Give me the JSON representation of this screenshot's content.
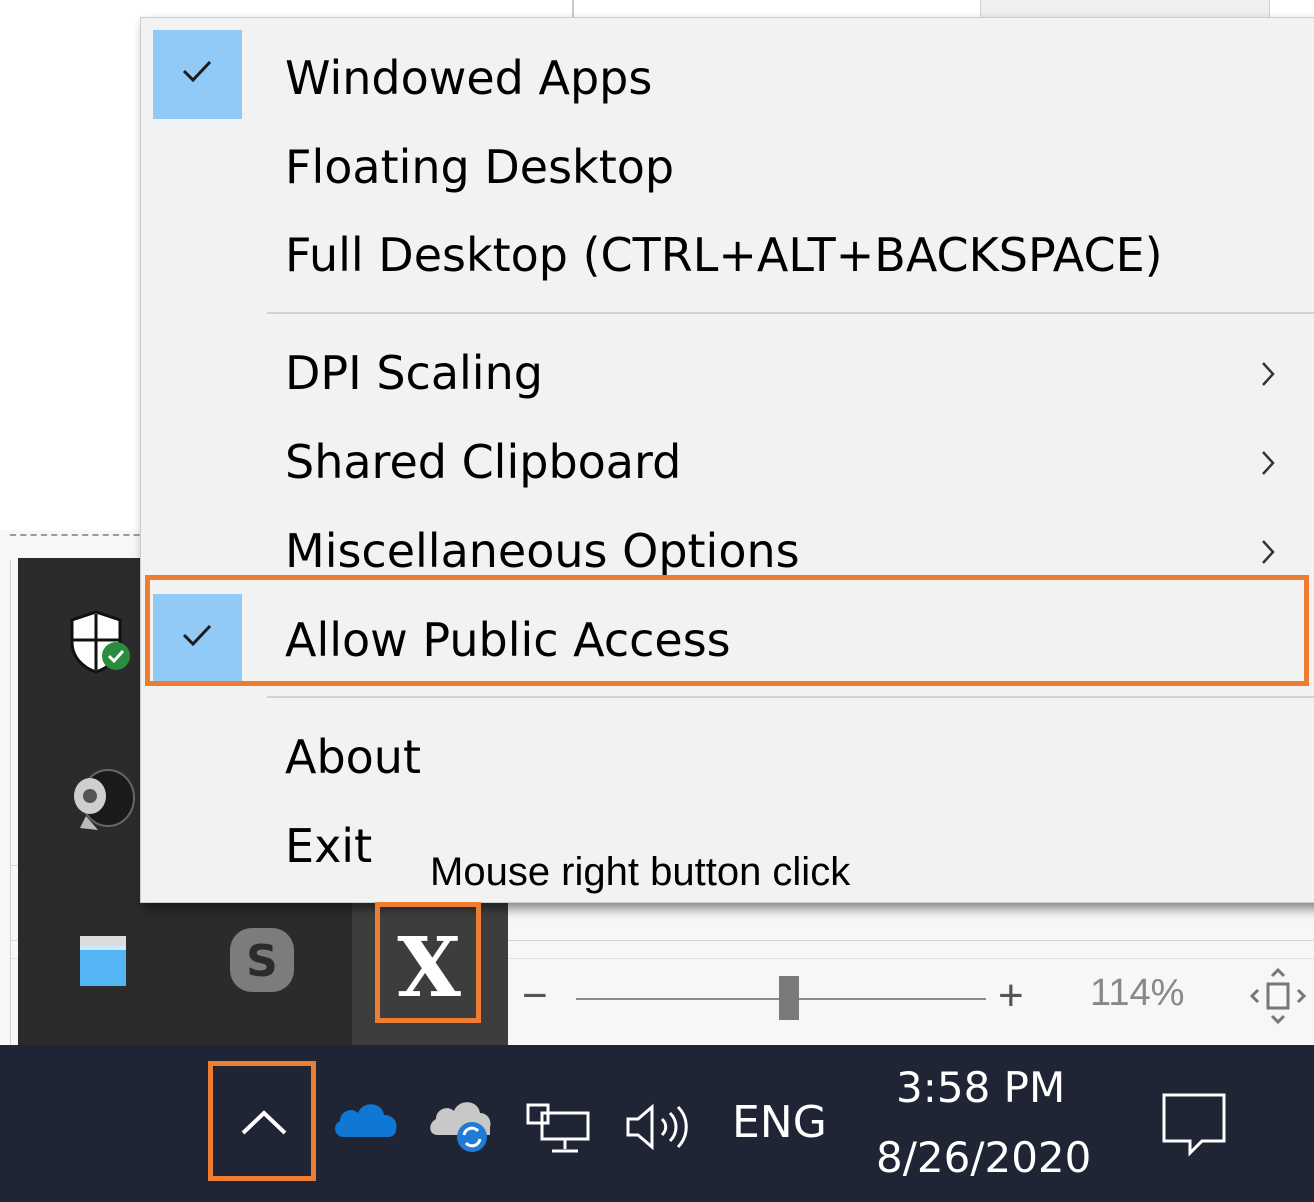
{
  "context_menu": {
    "items": [
      {
        "label": "Windowed Apps",
        "checked": true
      },
      {
        "label": "Floating Desktop",
        "checked": false
      },
      {
        "label": "Full Desktop (CTRL+ALT+BACKSPACE)",
        "checked": false
      },
      {
        "label": "DPI Scaling",
        "submenu": true
      },
      {
        "label": "Shared Clipboard",
        "submenu": true
      },
      {
        "label": "Miscellaneous Options",
        "submenu": true
      },
      {
        "label": "Allow Public Access",
        "checked": true
      },
      {
        "label": "About"
      },
      {
        "label": "Exit"
      }
    ]
  },
  "annotation": {
    "text": "Mouse right button click",
    "highlight_color": "#ed7d31"
  },
  "zoom": {
    "minus": "−",
    "plus": "+",
    "percent": "114%"
  },
  "tray_popup": {
    "icons": [
      "windows-security-shield-icon",
      "speaker-app-icon",
      "window-app-icon",
      "skype-icon",
      "x-app-icon"
    ],
    "x_icon_glyph": "X",
    "skype_glyph": "S"
  },
  "taskbar": {
    "language": "ENG",
    "time": "3:58 PM",
    "date": "8/26/2020",
    "icons": [
      "chevron-up-icon",
      "onedrive-icon",
      "onedrive-sync-icon",
      "network-icon",
      "volume-icon",
      "notification-icon"
    ]
  },
  "colors": {
    "menu_bg": "#f2f2f2",
    "check_bg": "#91c9f7",
    "taskbar_bg": "#1f2535",
    "popup_bg": "#2b2b2b"
  }
}
